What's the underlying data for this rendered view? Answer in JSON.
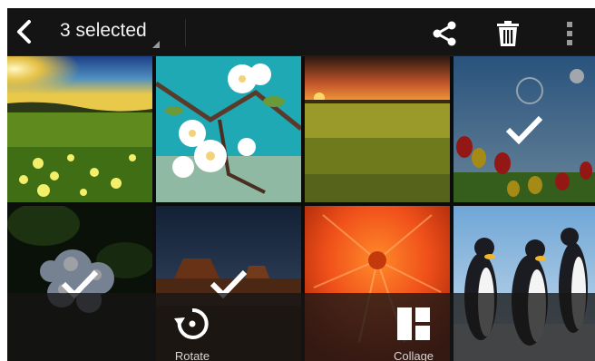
{
  "topbar": {
    "title": "3 selected",
    "back_icon": "back-arrow-icon",
    "actions": [
      {
        "name": "share",
        "icon": "share-icon"
      },
      {
        "name": "delete",
        "icon": "trash-icon"
      },
      {
        "name": "more",
        "icon": "overflow-menu-icon"
      }
    ]
  },
  "grid": {
    "tiles": [
      {
        "subject": "sunset-meadow",
        "selected": false
      },
      {
        "subject": "white-blossoms",
        "selected": false
      },
      {
        "subject": "sunset-field",
        "selected": false
      },
      {
        "subject": "tulips-sky",
        "selected": true
      },
      {
        "subject": "hydrangea",
        "selected": true
      },
      {
        "subject": "desert-mesa",
        "selected": true
      },
      {
        "subject": "orange-flower",
        "selected": false
      },
      {
        "subject": "penguins",
        "selected": false
      }
    ]
  },
  "bottombar": {
    "rotate_label": "Rotate",
    "collage_label": "Collage"
  },
  "colors": {
    "bar": "#141414",
    "text": "#f2f2f2",
    "check": "#ffffff"
  }
}
